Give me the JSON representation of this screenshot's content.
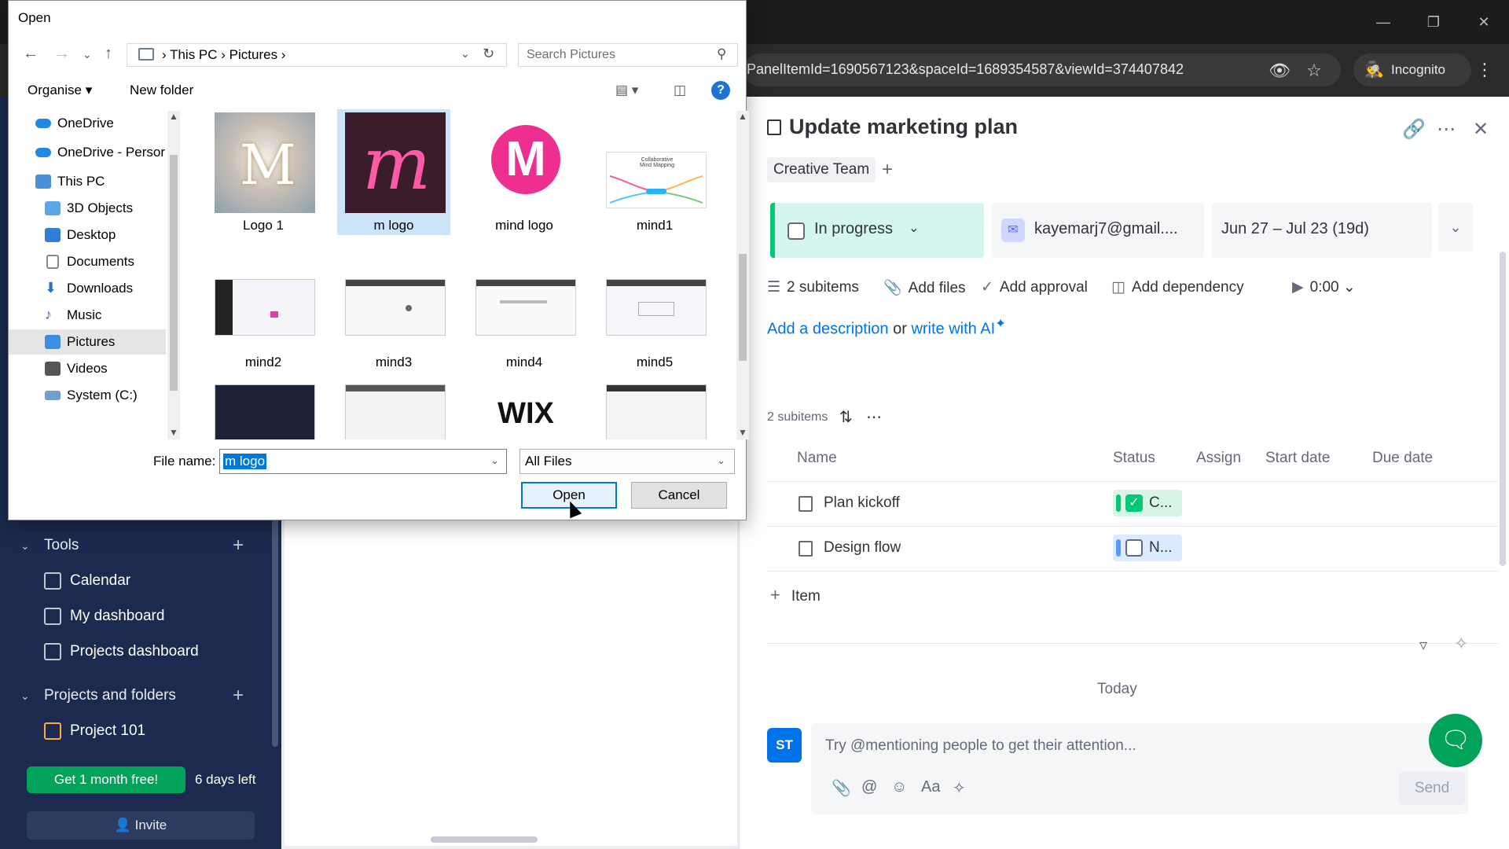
{
  "browser": {
    "url": "PanelItemId=1690567123&spaceId=1689354587&viewId=374407842",
    "incognito_label": "Incognito",
    "icons": [
      "eye-off-icon",
      "star-icon",
      "incognito-icon",
      "kebab-icon"
    ]
  },
  "sidebar": {
    "tools_label": "Tools",
    "tools_items": [
      {
        "label": "Calendar"
      },
      {
        "label": "My dashboard"
      },
      {
        "label": "Projects dashboard"
      }
    ],
    "projects_label": "Projects and folders",
    "project_items": [
      {
        "label": "Project 101"
      }
    ],
    "promo_button": "Get 1 month free!",
    "days_left": "6 days left",
    "invite_label": "Invite"
  },
  "panel": {
    "title": "Update marketing plan",
    "team_tag": "Creative Team",
    "status": "In progress",
    "assignee": "kayemarj7@gmail....",
    "dates": "Jun 27 – Jul 23 (19d)",
    "actions": {
      "subitems": "2 subitems",
      "add_files": "Add files",
      "add_approval": "Add approval",
      "add_dependency": "Add dependency",
      "timer": "0:00"
    },
    "description": {
      "prefix": "Add a description",
      "or": " or ",
      "link": "write with AI"
    },
    "subitems_header": "2 subitems",
    "columns": [
      "Name",
      "Status",
      "Assign",
      "Start date",
      "Due date"
    ],
    "rows": [
      {
        "name": "Plan kickoff",
        "status": "C...",
        "status_color": "#00c875",
        "checked": true
      },
      {
        "name": "Design flow",
        "status": "N...",
        "status_color": "#579bfc",
        "checked": false
      }
    ],
    "add_item": "Item",
    "today_label": "Today",
    "avatar_initials": "ST",
    "comment_placeholder": "Try @mentioning people to get their attention...",
    "font_label": "Aa",
    "send_label": "Send"
  },
  "dialog": {
    "title": "Open",
    "breadcrumb": [
      "This PC",
      "Pictures"
    ],
    "search_placeholder": "Search Pictures",
    "organise_label": "Organise",
    "new_folder_label": "New folder",
    "help_label": "?",
    "nav_items": [
      {
        "label": "OneDrive",
        "color": "#1e88e5"
      },
      {
        "label": "OneDrive - Persor",
        "color": "#1e88e5"
      },
      {
        "label": "This PC",
        "color": "#4a90d9"
      },
      {
        "label": "3D Objects",
        "color": "#5aa6e6"
      },
      {
        "label": "Desktop",
        "color": "#2f7fd8"
      },
      {
        "label": "Documents",
        "color": "#8a8a8a"
      },
      {
        "label": "Downloads",
        "color": "#2a6fd0"
      },
      {
        "label": "Music",
        "color": "#2a6fd0"
      },
      {
        "label": "Pictures",
        "color": "#3d8de0"
      },
      {
        "label": "Videos",
        "color": "#555555"
      },
      {
        "label": "System (C:)",
        "color": "#6f9fd0"
      }
    ],
    "files": [
      {
        "name": "Logo 1"
      },
      {
        "name": "m logo"
      },
      {
        "name": "mind  logo"
      },
      {
        "name": "mind1"
      },
      {
        "name": "mind2"
      },
      {
        "name": "mind3"
      },
      {
        "name": "mind4"
      },
      {
        "name": "mind5"
      },
      {
        "name": ""
      },
      {
        "name": ""
      },
      {
        "name": "WIX"
      },
      {
        "name": ""
      }
    ],
    "thumb_texts": {
      "mind1": "Collaborative Mind Mapping"
    },
    "file_name_label": "File name:",
    "file_name_value": "m logo",
    "file_type": "All Files",
    "open_label": "Open",
    "cancel_label": "Cancel"
  }
}
